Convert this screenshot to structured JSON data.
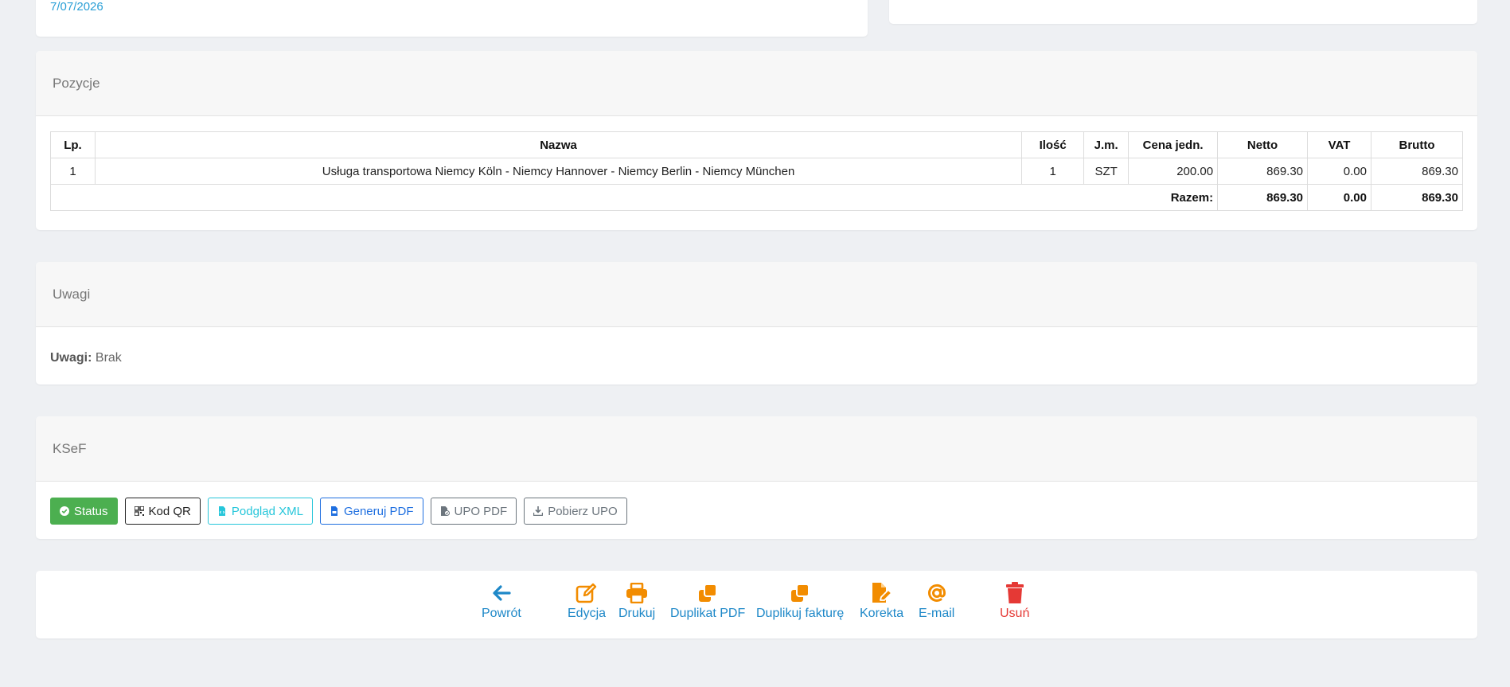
{
  "top": {
    "date": "7/07/2026"
  },
  "positions": {
    "title": "Pozycje",
    "headers": [
      "Lp.",
      "Nazwa",
      "Ilość",
      "J.m.",
      "Cena jedn.",
      "Netto",
      "VAT",
      "Brutto"
    ],
    "rows": [
      {
        "lp": "1",
        "name": "Usługa transportowa Niemcy Köln - Niemcy Hannover - Niemcy Berlin - Niemcy München",
        "qty": "1",
        "unit": "SZT",
        "unit_price": "200.00",
        "net": "869.30",
        "vat": "0.00",
        "gross": "869.30"
      }
    ],
    "total_label": "Razem:",
    "total_net": "869.30",
    "total_vat": "0.00",
    "total_gross": "869.30"
  },
  "remarks": {
    "title": "Uwagi",
    "label": "Uwagi:",
    "value": "Brak"
  },
  "ksef": {
    "title": "KSeF",
    "buttons": {
      "status": "Status",
      "qr": "Kod QR",
      "xml": "Podgląd XML",
      "pdf": "Generuj PDF",
      "upo_pdf": "UPO PDF",
      "upo_download": "Pobierz UPO"
    }
  },
  "actions": {
    "back": "Powrót",
    "edit": "Edycja",
    "print": "Drukuj",
    "duplicate_pdf": "Duplikat PDF",
    "duplicate_invoice": "Duplikuj fakturę",
    "correction": "Korekta",
    "email": "E-mail",
    "delete": "Usuń"
  },
  "colors": {
    "link_blue": "#1e88c8",
    "action_orange": "#f28c00",
    "danger_red": "#e53935",
    "status_green": "#4caf50",
    "xml_cyan": "#26c6da",
    "pdf_blue": "#1f6fe0",
    "secondary_gray": "#6c757d"
  },
  "icons": {
    "back": "arrow-left-icon",
    "edit": "edit-icon",
    "print": "printer-icon",
    "duplicate_pdf": "copy-icon",
    "duplicate_invoice": "copy-icon",
    "correction": "file-edit-icon",
    "email": "at-sign-icon",
    "delete": "trash-icon"
  }
}
